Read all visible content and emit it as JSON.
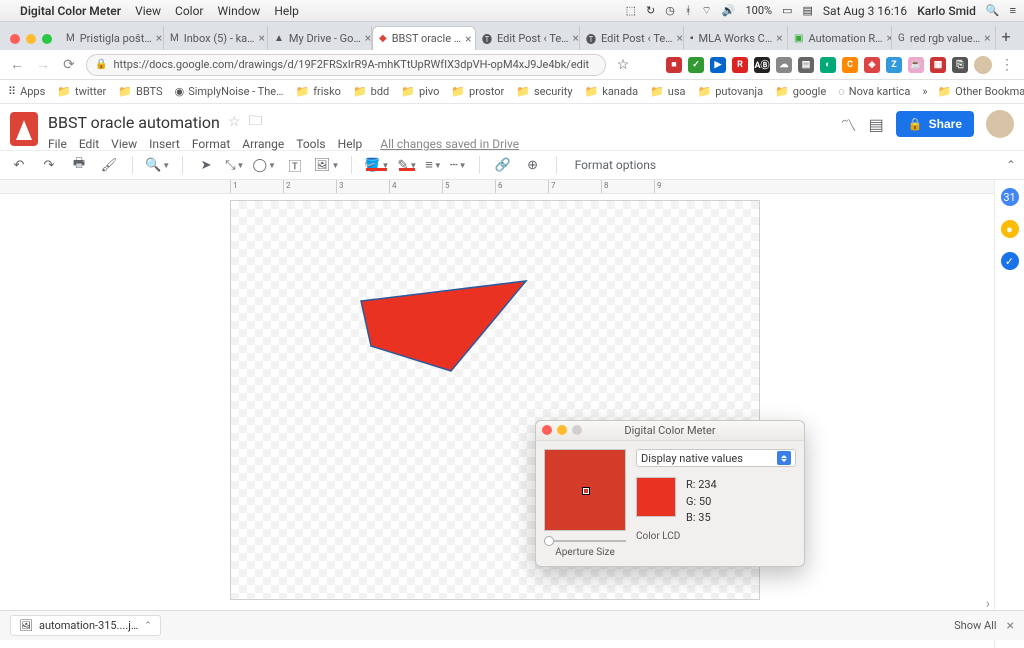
{
  "menubar": {
    "app_name": "Digital Color Meter",
    "items": [
      "View",
      "Color",
      "Window",
      "Help"
    ],
    "battery": "100%",
    "clock": "Sat Aug 3  16:16",
    "user": "Karlo Smid"
  },
  "tabs": [
    {
      "label": "Pristigla pošt…"
    },
    {
      "label": "Inbox (5) - ka…"
    },
    {
      "label": "My Drive - Go…"
    },
    {
      "label": "BBST oracle …",
      "active": true
    },
    {
      "label": "Edit Post ‹ Te…"
    },
    {
      "label": "Edit Post ‹ Te…"
    },
    {
      "label": "MLA Works C…"
    },
    {
      "label": "Automation R…"
    },
    {
      "label": "red rgb value…"
    }
  ],
  "url": "https://docs.google.com/drawings/d/19F2FRSxIrR9A-mhKTtUpRWfIX3dpVH-opM4xJ9Je4bk/edit",
  "bookmarks": {
    "items": [
      {
        "label": "Apps"
      },
      {
        "label": "twitter",
        "folder": true
      },
      {
        "label": "BBTS",
        "folder": true
      },
      {
        "label": "SimplyNoise - The…"
      },
      {
        "label": "frisko",
        "folder": true
      },
      {
        "label": "bdd",
        "folder": true
      },
      {
        "label": "pivo",
        "folder": true
      },
      {
        "label": "prostor",
        "folder": true
      },
      {
        "label": "security",
        "folder": true
      },
      {
        "label": "kanada",
        "folder": true
      },
      {
        "label": "usa",
        "folder": true
      },
      {
        "label": "putovanja",
        "folder": true
      },
      {
        "label": "google",
        "folder": true
      },
      {
        "label": "Nova kartica"
      }
    ],
    "other": "Other Bookmarks"
  },
  "doc": {
    "title": "BBST oracle automation",
    "menus": [
      "File",
      "Edit",
      "View",
      "Insert",
      "Format",
      "Arrange",
      "Tools",
      "Help"
    ],
    "saved": "All changes saved in Drive",
    "share": "Share",
    "format_options": "Format options"
  },
  "ruler_labels": [
    "1",
    "2",
    "3",
    "4",
    "5",
    "6",
    "7",
    "8",
    "9"
  ],
  "dcm": {
    "title": "Digital Color Meter",
    "dropdown": "Display native values",
    "r_label": "R:",
    "r": "234",
    "g_label": "G:",
    "g": "50",
    "b_label": "B:",
    "b": "35",
    "display": "Color LCD",
    "aperture": "Aperture Size"
  },
  "download": {
    "file": "automation-315....j…",
    "showall": "Show All"
  }
}
